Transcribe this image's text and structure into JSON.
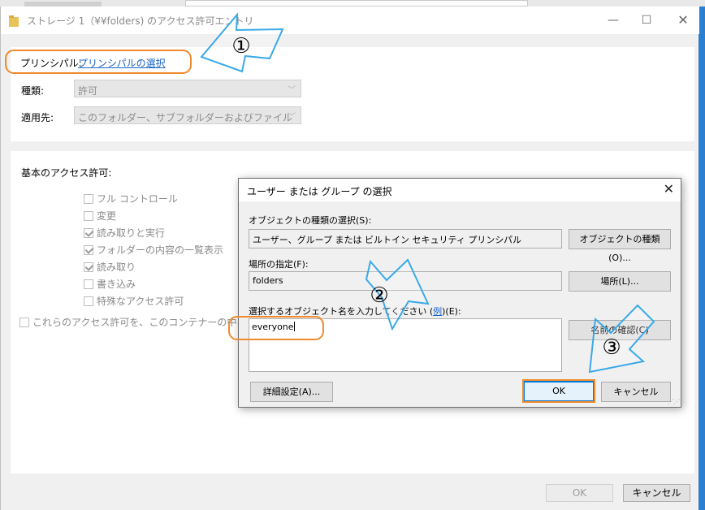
{
  "main_window": {
    "title": "ストレージ 1（¥¥folders) のアクセス許可エントリ",
    "principal_label": "プリンシパル:",
    "principal_link": "プリンシパルの選択",
    "type_label": "種類:",
    "type_value": "許可",
    "applies_label": "適用先:",
    "applies_value": "このフォルダー、サブフォルダーおよびファイル",
    "basic_perms_label": "基本のアクセス許可:",
    "permissions": [
      {
        "label": "フル コントロール",
        "checked": false
      },
      {
        "label": "変更",
        "checked": false
      },
      {
        "label": "読み取りと実行",
        "checked": true
      },
      {
        "label": "フォルダーの内容の一覧表示",
        "checked": true
      },
      {
        "label": "読み取り",
        "checked": true
      },
      {
        "label": "書き込み",
        "checked": false
      },
      {
        "label": "特殊なアクセス許可",
        "checked": false
      }
    ],
    "apply_only_label": "これらのアクセス許可を、このコンテナーの中にある",
    "ok_label": "OK",
    "cancel_label": "キャンセル"
  },
  "dialog": {
    "title": "ユーザー または グループ の選択",
    "object_type_label": "オブジェクトの種類の選択(S):",
    "object_type_value": "ユーザー、グループ または ビルトイン セキュリティ プリンシパル",
    "object_type_button": "オブジェクトの種類(O)...",
    "location_label": "場所の指定(F):",
    "location_value": "folders",
    "location_button": "場所(L)...",
    "enter_name_label": "選択するオブジェクト名を入力してください (",
    "examples_link": "例",
    "enter_name_label_end": ")(E):",
    "object_name_value": "everyone",
    "check_names_button": "名前の確認(C)",
    "advanced_button": "詳細設定(A)...",
    "ok_button": "OK",
    "cancel_button": "キャンセル"
  },
  "annotations": {
    "marker_1": "①",
    "marker_2": "②",
    "marker_3": "③",
    "highlight_color": "#f08a2c",
    "arrow_color": "#3aa9e8"
  },
  "icons": {
    "title_icon": "folder-icon",
    "minimize": "minimize-icon",
    "maximize": "maximize-icon",
    "close": "close-icon"
  }
}
